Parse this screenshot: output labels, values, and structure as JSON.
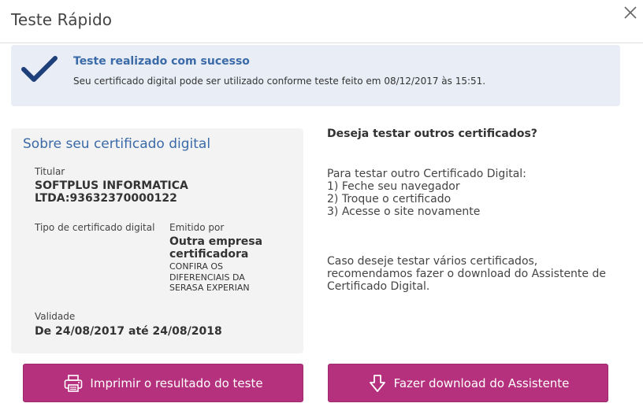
{
  "header": {
    "title": "Teste Rápido"
  },
  "banner": {
    "title": "Teste realizado com sucesso",
    "message": "Seu certificado digital pode ser utilizado conforme teste feito em 08/12/2017 às 15:51."
  },
  "certificate": {
    "title": "Sobre seu certificado digital",
    "holder_label": "Titular",
    "holder_line1": "SOFTPLUS INFORMATICA",
    "holder_line2": "LTDA:93632370000122",
    "type_label": "Tipo de certificado digital",
    "issuer_label": "Emitido por",
    "issuer_line1": "Outra empresa",
    "issuer_line2": "certificadora",
    "issuer_note_line1": "CONFIRA OS",
    "issuer_note_line2": "DIFERENCIAIS DA",
    "issuer_note_line3": "SERASA EXPERIAN",
    "validity_label": "Validade",
    "validity_value": "De 24/08/2017 até 24/08/2018"
  },
  "other": {
    "title": "Deseja testar outros certificados?",
    "intro": "Para testar outro Certificado Digital:",
    "step1": "1) Feche seu navegador",
    "step2": "2) Troque o certificado",
    "step3": "3) Acesse o site novamente",
    "note_line1": "Caso deseje testar vários certificados,",
    "note_line2": "recomendamos fazer o download do Assistente de",
    "note_line3": "Certificado Digital."
  },
  "buttons": {
    "print_label": "Imprimir o resultado do teste",
    "download_label": "Fazer download do Assistente"
  },
  "colors": {
    "accent_blue": "#3b6aa8",
    "button_magenta": "#b5317e",
    "banner_bg": "#e8edf6",
    "check_navy": "#1f3f7a"
  },
  "icons": {
    "close": "close-icon",
    "check": "checkmark-icon",
    "print": "printer-icon",
    "download": "download-arrow-icon"
  }
}
